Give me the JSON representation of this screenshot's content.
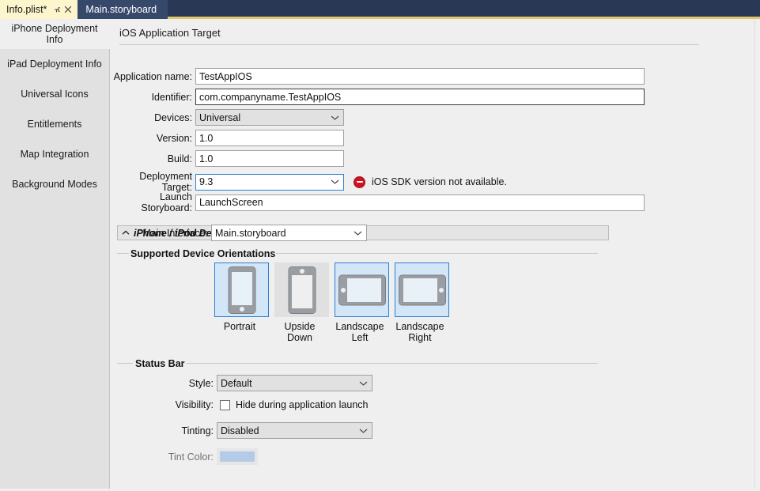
{
  "window": {
    "tab_strip_bg": "#293955",
    "tab_strip_underline": "#e3c869"
  },
  "tabs": [
    {
      "label": "Info.plist*",
      "state": "active",
      "pin_icon": "pin-icon",
      "close_icon": "close-icon"
    },
    {
      "label": "Main.storyboard",
      "state": "inactive"
    }
  ],
  "sidebar": {
    "items": [
      {
        "label": "iPhone Deployment Info",
        "selected": true
      },
      {
        "label": "iPad Deployment Info",
        "selected": false
      },
      {
        "label": "Universal Icons",
        "selected": false
      },
      {
        "label": "Entitlements",
        "selected": false
      },
      {
        "label": "Map Integration",
        "selected": false
      },
      {
        "label": "Background Modes",
        "selected": false
      }
    ]
  },
  "main": {
    "page_title": "iOS Application Target",
    "fields": {
      "application_name": {
        "label": "Application name:",
        "value": "TestAppIOS"
      },
      "identifier": {
        "label": "Identifier:",
        "value": "com.companyname.TestAppIOS"
      },
      "devices": {
        "label": "Devices:",
        "value": "Universal"
      },
      "version": {
        "label": "Version:",
        "value": "1.0"
      },
      "build": {
        "label": "Build:",
        "value": "1.0"
      },
      "deployment_target": {
        "label": "Deployment Target:",
        "value": "9.3"
      },
      "launch_storyboard": {
        "label": "Launch Storyboard:",
        "value": "LaunchScreen"
      }
    },
    "validation": {
      "icon": "error-icon",
      "icon_color": "#cf1322",
      "message": "iOS SDK version not available."
    },
    "collapsible": {
      "caret_icon": "chevron-up-icon",
      "title": "iPhone / iPod Deployment Info"
    },
    "main_interface": {
      "label": "Main Interface:",
      "value": "Main.storyboard"
    },
    "orientations": {
      "caption": "Supported Device Orientations",
      "selected_color": "#d3e6f7",
      "border_color": "#2c7fd0",
      "items": [
        {
          "label": "Portrait",
          "label2": "",
          "kind": "portrait",
          "selected": true
        },
        {
          "label": "Upside",
          "label2": "Down",
          "kind": "upside-down",
          "selected": false
        },
        {
          "label": "Landscape",
          "label2": "Left",
          "kind": "landscape-left",
          "selected": true
        },
        {
          "label": "Landscape",
          "label2": "Right",
          "kind": "landscape-right",
          "selected": true
        }
      ]
    },
    "status_bar": {
      "caption": "Status Bar",
      "style": {
        "label": "Style:",
        "value": "Default"
      },
      "visibility": {
        "label": "Visibility:",
        "checkbox_label": "Hide during application launch",
        "checked": false
      },
      "tinting": {
        "label": "Tinting:",
        "value": "Disabled"
      },
      "tint_color": {
        "label": "Tint Color:",
        "swatch": "#b3cbe6",
        "enabled": false
      }
    }
  }
}
